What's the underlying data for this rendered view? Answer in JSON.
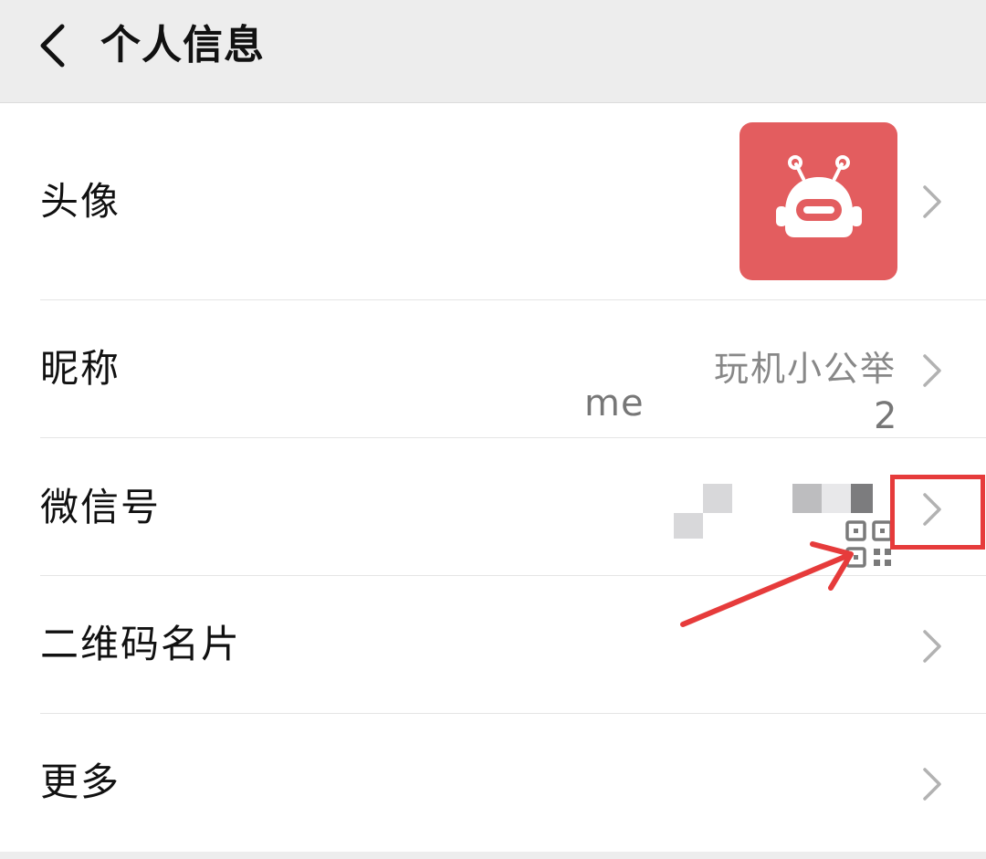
{
  "header": {
    "title": "个人信息",
    "back_icon": "chevron-left-icon"
  },
  "rows": [
    {
      "label": "头像",
      "value": "",
      "type": "avatar",
      "avatar_color": "#e35d5f"
    },
    {
      "label": "昵称",
      "value": "玩机小公举",
      "type": "text"
    },
    {
      "label": "微信号",
      "value_prefix": "me",
      "value_suffix": "2",
      "type": "masked"
    },
    {
      "label": "二维码名片",
      "icon": "qr-code-icon",
      "type": "icon"
    },
    {
      "label": "更多",
      "value": "",
      "type": "plain"
    }
  ],
  "colors": {
    "background": "#ededed",
    "surface": "#ffffff",
    "text_primary": "#111111",
    "text_secondary": "#888888",
    "chevron": "#b2b2b2",
    "annotation_red": "#e63b3b"
  }
}
